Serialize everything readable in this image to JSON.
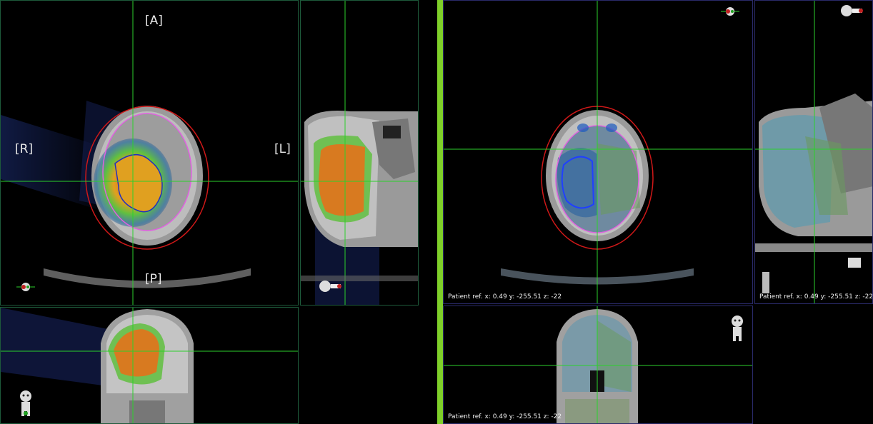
{
  "left_panel": {
    "axial": {
      "anterior": "[A]",
      "posterior": "[P]",
      "right": "[R]",
      "left": "[L]"
    }
  },
  "right_panel": {
    "axial_readout": "Patient ref. x: 0.49 y: -255.51 z: -22",
    "sagittal_readout": "Patient ref. x: 0.49 y: -255.51 z: -22",
    "coronal_readout": "Patient ref. x: 0.49 y: -255.51 z: -22"
  },
  "colors": {
    "crosshair": "#2bd12b",
    "frame_left": "#1d5a3a",
    "frame_right": "#2a2a6a",
    "divider": "#7fcf2a",
    "body_contour": "#d01818",
    "brain_contour": "#e060e0",
    "target_contour": "#2040ff"
  },
  "icons": [
    "orientation-head-icon",
    "orientation-figure-icon"
  ]
}
